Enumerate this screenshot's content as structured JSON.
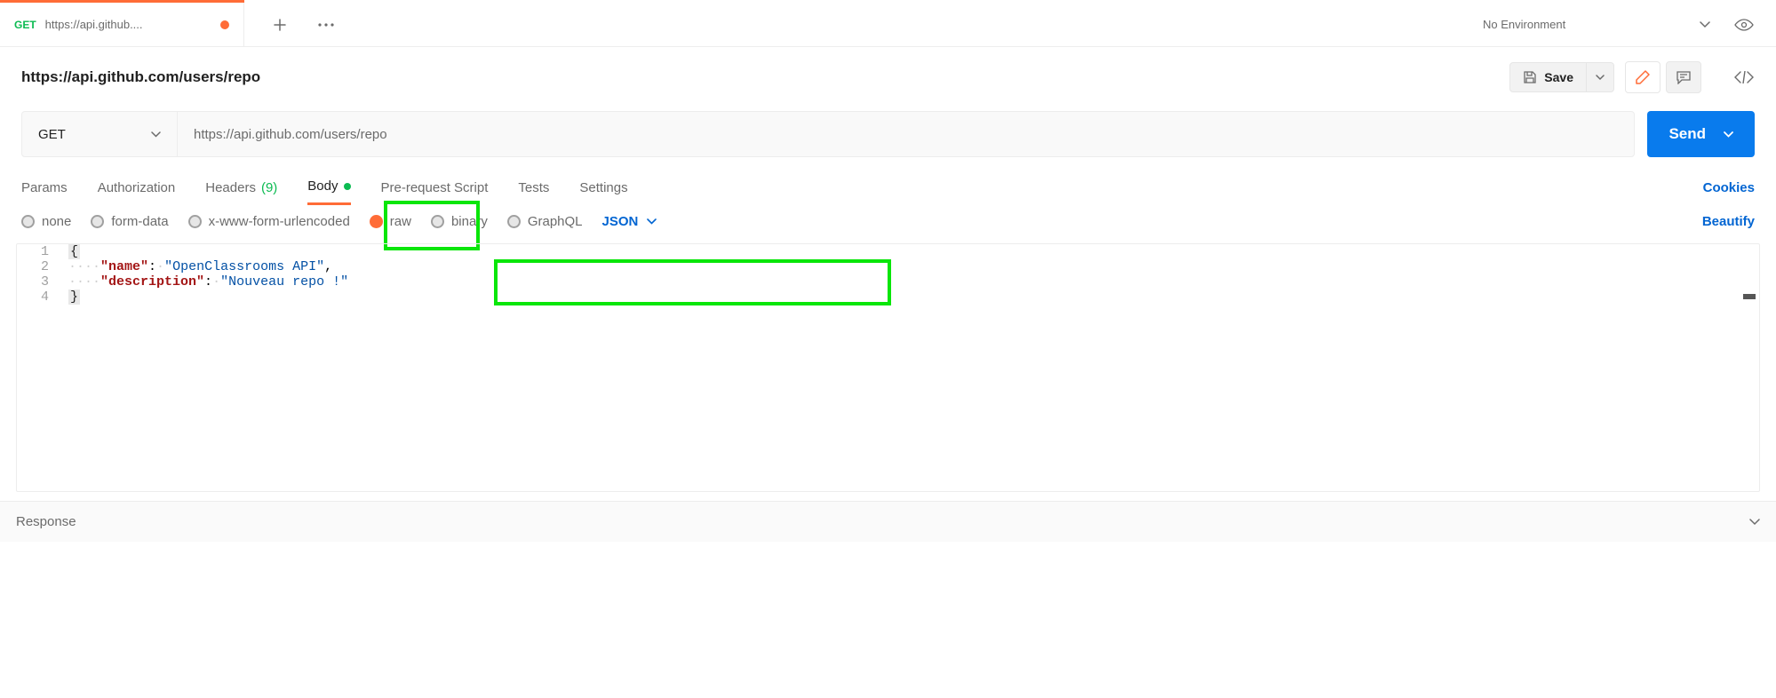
{
  "tab": {
    "method": "GET",
    "title": "https://api.github...."
  },
  "envSelector": "No Environment",
  "request": {
    "title": "https://api.github.com/users/repo",
    "method": "GET",
    "url": "https://api.github.com/users/repo"
  },
  "actions": {
    "save": "Save",
    "send": "Send"
  },
  "reqTabs": {
    "params": "Params",
    "auth": "Authorization",
    "headers": "Headers",
    "headerCount": "(9)",
    "body": "Body",
    "prerequest": "Pre-request Script",
    "tests": "Tests",
    "settings": "Settings"
  },
  "links": {
    "cookies": "Cookies",
    "beautify": "Beautify"
  },
  "bodyTypes": {
    "none": "none",
    "formData": "form-data",
    "urlencoded": "x-www-form-urlencoded",
    "raw": "raw",
    "binary": "binary",
    "graphql": "GraphQL",
    "format": "JSON"
  },
  "editor": {
    "lines": [
      "1",
      "2",
      "3",
      "4"
    ],
    "l1": "{",
    "l2_key": "\"name\"",
    "l2_val": "\"OpenClassrooms API\"",
    "l3_key": "\"description\"",
    "l3_val": "\"Nouveau repo !\"",
    "l4": "}"
  },
  "response": "Response"
}
